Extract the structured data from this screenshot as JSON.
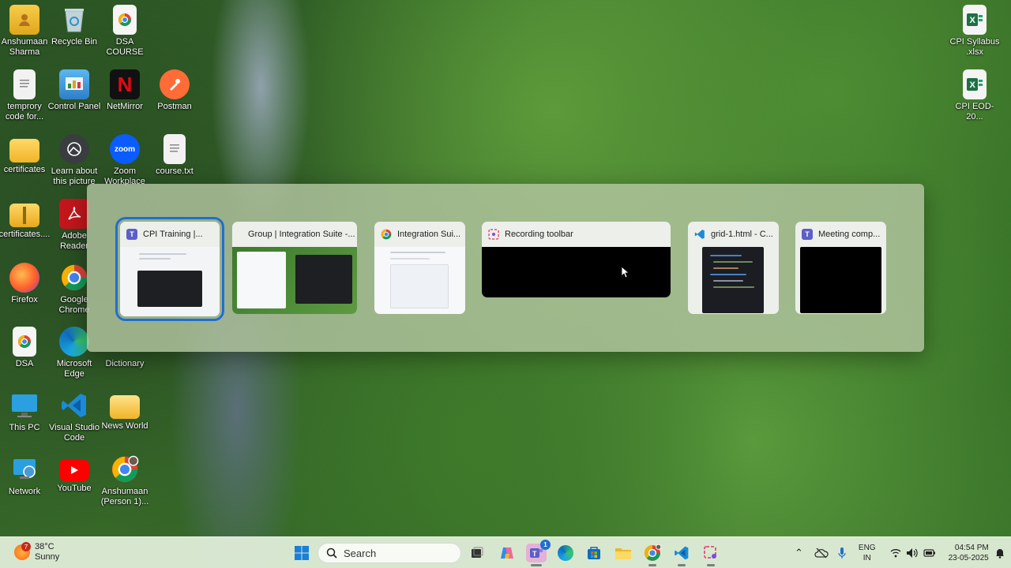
{
  "desktop": {
    "icons": [
      {
        "label": "Anshumaan Sharma",
        "icon": "user-folder-icon"
      },
      {
        "label": "Recycle Bin",
        "icon": "recycle-bin-icon"
      },
      {
        "label": "DSA COURSE",
        "icon": "chrome-icon"
      },
      {
        "label": "temprory code for...",
        "icon": "text-file-icon"
      },
      {
        "label": "Control Panel",
        "icon": "control-panel-icon"
      },
      {
        "label": "NetMirror",
        "icon": "netmirror-icon"
      },
      {
        "label": "Postman",
        "icon": "postman-icon"
      },
      {
        "label": "certificates",
        "icon": "folder-icon"
      },
      {
        "label": "Learn about this picture",
        "icon": "camera-icon"
      },
      {
        "label": "Zoom Workplace",
        "icon": "zoom-icon"
      },
      {
        "label": "course.txt",
        "icon": "text-file-icon"
      },
      {
        "label": "certificates....",
        "icon": "zip-folder-icon"
      },
      {
        "label": "Adobe Reader",
        "icon": "adobe-icon"
      },
      {
        "label": "Firefox",
        "icon": "firefox-icon"
      },
      {
        "label": "Google Chrome",
        "icon": "chrome-icon"
      },
      {
        "label": "DSA",
        "icon": "chrome-doc-icon"
      },
      {
        "label": "Microsoft Edge",
        "icon": "edge-icon"
      },
      {
        "label": "Dictionary",
        "icon": "dictionary-icon"
      },
      {
        "label": "This PC",
        "icon": "this-pc-icon"
      },
      {
        "label": "Visual Studio Code",
        "icon": "vscode-icon"
      },
      {
        "label": "News World",
        "icon": "folder-icon"
      },
      {
        "label": "Network",
        "icon": "network-icon"
      },
      {
        "label": "YouTube",
        "icon": "youtube-icon"
      },
      {
        "label": "Anshumaan (Person 1)...",
        "icon": "chrome-profile-icon"
      },
      {
        "label": "CPI Syllabus .xlsx",
        "icon": "excel-icon"
      },
      {
        "label": "CPI EOD-20...",
        "icon": "excel-icon"
      }
    ]
  },
  "switcher": {
    "windows": [
      {
        "title": "CPI Training |...",
        "app": "teams-icon",
        "selected": true
      },
      {
        "title": "Group | Integration Suite -...",
        "app": "none"
      },
      {
        "title": "Integration Sui...",
        "app": "chrome-icon"
      },
      {
        "title": "Recording toolbar",
        "app": "snipping-tool-icon"
      },
      {
        "title": "grid-1.html - C...",
        "app": "vscode-icon"
      },
      {
        "title": "Meeting comp...",
        "app": "teams-icon"
      }
    ]
  },
  "taskbar": {
    "weather": {
      "temp": "38°C",
      "condition": "Sunny",
      "badge": "7"
    },
    "search_placeholder": "Search",
    "teams_badge": "1",
    "tray": {
      "lang_top": "ENG",
      "lang_bottom": "IN",
      "time": "04:54 PM",
      "date": "23-05-2025"
    }
  },
  "colors": {
    "accent": "#1f6fd0",
    "taskbar": "#e1eeda",
    "switcher": "#b2c4a0"
  }
}
